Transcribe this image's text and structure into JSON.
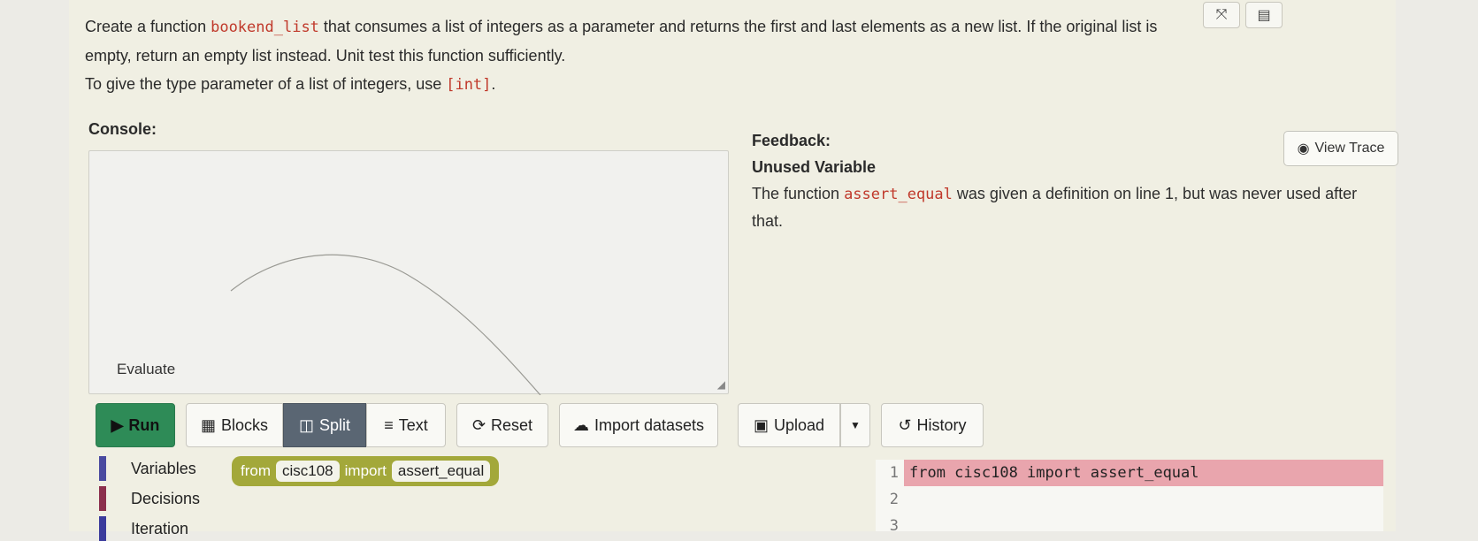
{
  "instructions": {
    "p1_before": "Create a function ",
    "p1_code": "bookend_list",
    "p1_after": " that consumes a list of integers as a parameter and returns the first and last elements as a new list. If the original list is empty, return an empty list instead. Unit test this function sufficiently.",
    "p2_before": "To give the type parameter of a list of integers, use ",
    "p2_code": "[int]",
    "p2_after": "."
  },
  "top_icons": [
    {
      "icon": "shuffle-icon",
      "glyph": "⤧"
    },
    {
      "icon": "list-icon",
      "glyph": "▤"
    }
  ],
  "console": {
    "label": "Console:",
    "evaluate_label": "Evaluate"
  },
  "feedback": {
    "label": "Feedback:",
    "title": "Unused Variable",
    "msg_before": "The function ",
    "msg_code": "assert_equal",
    "msg_after": " was given a definition on line 1, but was never used after that.",
    "view_trace": "View Trace"
  },
  "toolbar": {
    "run": "Run",
    "blocks": "Blocks",
    "split": "Split",
    "text": "Text",
    "reset": "Reset",
    "import_datasets": "Import datasets",
    "upload": "Upload",
    "history": "History"
  },
  "categories": [
    {
      "label": "Variables",
      "color": "#4a4aa0"
    },
    {
      "label": "Decisions",
      "color": "#8c2f4d"
    },
    {
      "label": "Iteration",
      "color": "#3b3b9c"
    }
  ],
  "block": {
    "from": "from",
    "module": "cisc108",
    "import": "import",
    "name": "assert_equal"
  },
  "editor": {
    "line_numbers": [
      "1",
      "2",
      "3"
    ],
    "lines": [
      "from cisc108 import assert_equal",
      "",
      ""
    ]
  }
}
